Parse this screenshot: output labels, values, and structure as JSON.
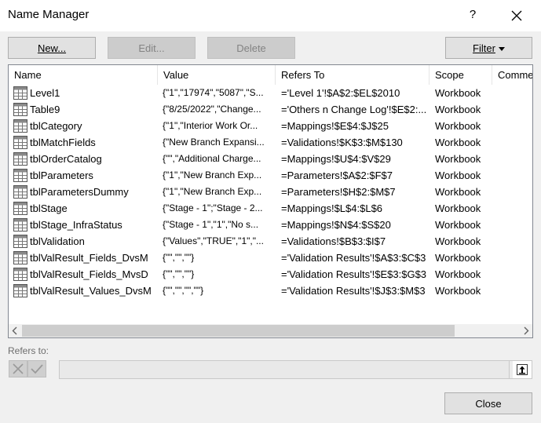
{
  "window": {
    "title": "Name Manager",
    "help_label": "?"
  },
  "toolbar": {
    "new_label": "New...",
    "edit_label": "Edit...",
    "delete_label": "Delete",
    "filter_label": "Filter"
  },
  "columns": [
    "Name",
    "Value",
    "Refers To",
    "Scope",
    "Comme"
  ],
  "rows": [
    {
      "name": "Level1",
      "value": "{\"1\",\"17974\",\"5087\",\"S...",
      "refers_to": "='Level 1'!$A$2:$EL$2010",
      "scope": "Workbook"
    },
    {
      "name": "Table9",
      "value": "{\"8/25/2022\",\"Change...",
      "refers_to": "='Others n Change Log'!$E$2:...",
      "scope": "Workbook"
    },
    {
      "name": "tblCategory",
      "value": "{\"1\",\"Interior Work Or...",
      "refers_to": "=Mappings!$E$4:$J$25",
      "scope": "Workbook"
    },
    {
      "name": "tblMatchFields",
      "value": "{\"New Branch Expansi...",
      "refers_to": "=Validations!$K$3:$M$130",
      "scope": "Workbook"
    },
    {
      "name": "tblOrderCatalog",
      "value": "{\"\",\"Additional Charge...",
      "refers_to": "=Mappings!$U$4:$V$29",
      "scope": "Workbook"
    },
    {
      "name": "tblParameters",
      "value": "{\"1\",\"New Branch Exp...",
      "refers_to": "=Parameters!$A$2:$F$7",
      "scope": "Workbook"
    },
    {
      "name": "tblParametersDummy",
      "value": "{\"1\",\"New Branch Exp...",
      "refers_to": "=Parameters!$H$2:$M$7",
      "scope": "Workbook"
    },
    {
      "name": "tblStage",
      "value": "{\"Stage - 1\";\"Stage - 2...",
      "refers_to": "=Mappings!$L$4:$L$6",
      "scope": "Workbook"
    },
    {
      "name": "tblStage_InfraStatus",
      "value": "{\"Stage - 1\",\"1\",\"No s...",
      "refers_to": "=Mappings!$N$4:$S$20",
      "scope": "Workbook"
    },
    {
      "name": "tblValidation",
      "value": "{\"Values\",\"TRUE\",\"1\",\"...",
      "refers_to": "=Validations!$B$3:$I$7",
      "scope": "Workbook"
    },
    {
      "name": "tblValResult_Fields_DvsM",
      "value": "{\"\",\"\",\"\"}",
      "refers_to": "='Validation Results'!$A$3:$C$3",
      "scope": "Workbook"
    },
    {
      "name": "tblValResult_Fields_MvsD",
      "value": "{\"\",\"\",\"\"}",
      "refers_to": "='Validation Results'!$E$3:$G$3",
      "scope": "Workbook"
    },
    {
      "name": "tblValResult_Values_DvsM",
      "value": "{\"\",\"\",\"\",\"\"}",
      "refers_to": "='Validation Results'!$J$3:$M$3",
      "scope": "Workbook"
    }
  ],
  "refers_to": {
    "label": "Refers to:",
    "value": ""
  },
  "footer": {
    "close_label": "Close"
  },
  "icons": {
    "close": "close-icon",
    "table": "table-icon",
    "cancel": "cancel-x-icon",
    "check": "checkmark-icon",
    "collapse": "collapse-dialog-icon",
    "scroll_left": "scroll-left-arrow-icon",
    "scroll_right": "scroll-right-arrow-icon"
  }
}
